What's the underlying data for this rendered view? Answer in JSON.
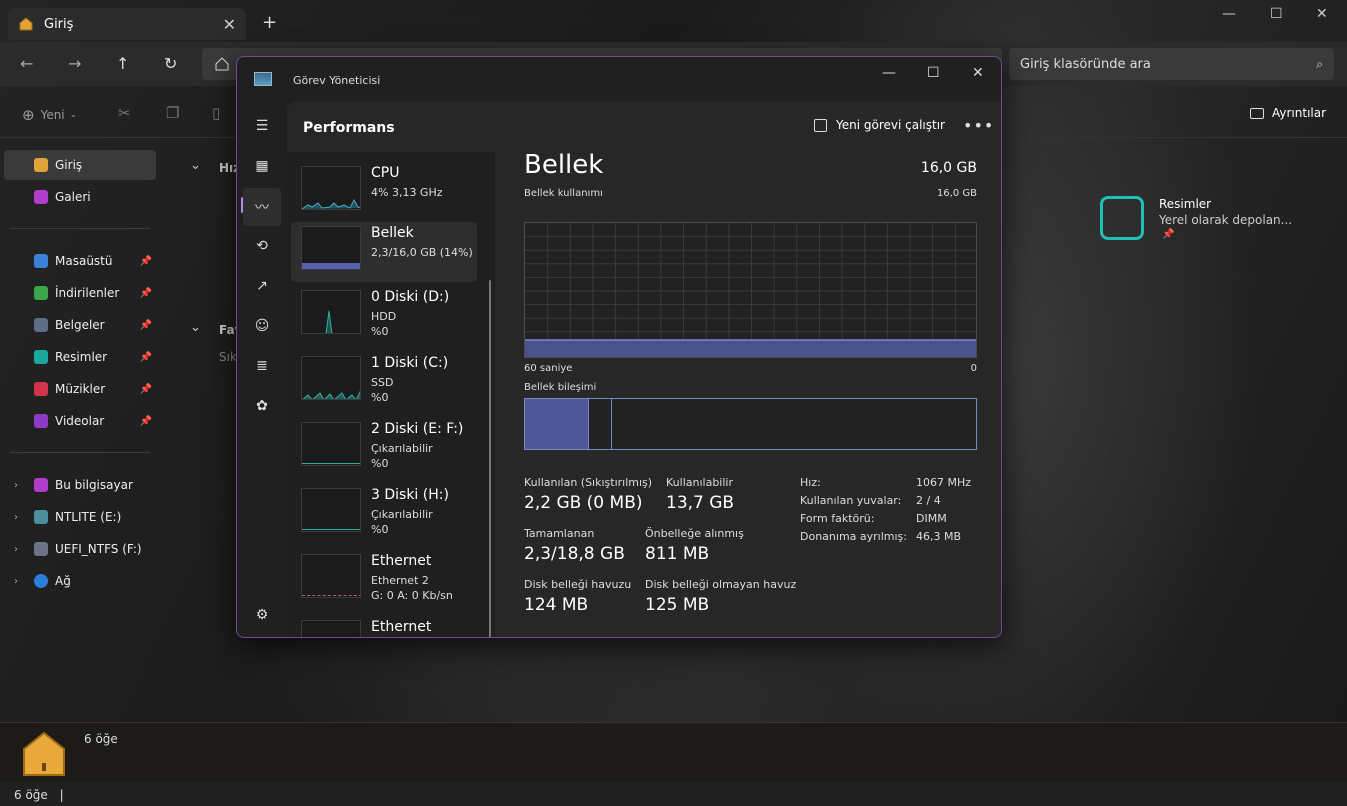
{
  "explorer": {
    "tab_title": "Giriş",
    "tab_close": "✕",
    "new_tab": "+",
    "search_placeholder": "Giriş klasöründe ara",
    "cmd_new": "Yeni",
    "details_label": "Ayrıntılar",
    "sidebar": {
      "items": [
        {
          "label": "Giriş"
        },
        {
          "label": "Galeri"
        },
        {
          "label": "Masaüstü"
        },
        {
          "label": "İndirilenler"
        },
        {
          "label": "Belgeler"
        },
        {
          "label": "Resimler"
        },
        {
          "label": "Müzikler"
        },
        {
          "label": "Videolar"
        },
        {
          "label": "Bu bilgisayar"
        },
        {
          "label": "NTLITE (E:)"
        },
        {
          "label": "UEFI_NTFS (F:)"
        },
        {
          "label": "Ağ"
        }
      ]
    },
    "main": {
      "section1_partial": "Hız",
      "section2_partial": "Fav",
      "section2_sub_partial": "Sık",
      "card_title": "Resimler",
      "card_sub": "Yerel olarak depolan..."
    },
    "footer_count": "6 öğe",
    "status_count": "6 öğe"
  },
  "taskmanager": {
    "title": "Görev Yöneticisi",
    "page": "Performans",
    "run_new_task": "Yeni görevi çalıştır",
    "list": [
      {
        "name": "CPU",
        "sub1": "4% 3,13 GHz",
        "sub2": ""
      },
      {
        "name": "Bellek",
        "sub1": "2,3/16,0 GB (14%)",
        "sub2": ""
      },
      {
        "name": "0 Diski (D:)",
        "sub1": "HDD",
        "sub2": "%0"
      },
      {
        "name": "1 Diski (C:)",
        "sub1": "SSD",
        "sub2": "%0"
      },
      {
        "name": "2 Diski (E: F:)",
        "sub1": "Çıkarılabilir",
        "sub2": "%0"
      },
      {
        "name": "3 Diski (H:)",
        "sub1": "Çıkarılabilir",
        "sub2": "%0"
      },
      {
        "name": "Ethernet",
        "sub1": "Ethernet 2",
        "sub2": "G: 0 A: 0 Kb/sn"
      },
      {
        "name": "Ethernet",
        "sub1": "",
        "sub2": ""
      }
    ],
    "memory": {
      "title": "Bellek",
      "total": "16,0 GB",
      "usage_label": "Bellek kullanımı",
      "usage_max": "16,0 GB",
      "time_left": "60 saniye",
      "time_right": "0",
      "composition_label": "Bellek bileşimi",
      "in_use_label": "Kullanılan (Sıkıştırılmış)",
      "in_use_value": "2,2 GB (0 MB)",
      "available_label": "Kullanılabilir",
      "available_value": "13,7 GB",
      "committed_label": "Tamamlanan",
      "committed_value": "2,3/18,8 GB",
      "cached_label": "Önbelleğe alınmış",
      "cached_value": "811 MB",
      "paged_label": "Disk belleği havuzu",
      "paged_value": "124 MB",
      "nonpaged_label": "Disk belleği olmayan havuz",
      "nonpaged_value": "125 MB",
      "specs": [
        {
          "k": "Hız:",
          "v": "1067 MHz"
        },
        {
          "k": "Kullanılan yuvalar:",
          "v": "2 / 4"
        },
        {
          "k": "Form faktörü:",
          "v": "DIMM"
        },
        {
          "k": "Donanıma ayrılmış:",
          "v": "46,3 MB"
        }
      ],
      "usage_fraction": 0.14
    },
    "accent": "#7b86d8"
  }
}
